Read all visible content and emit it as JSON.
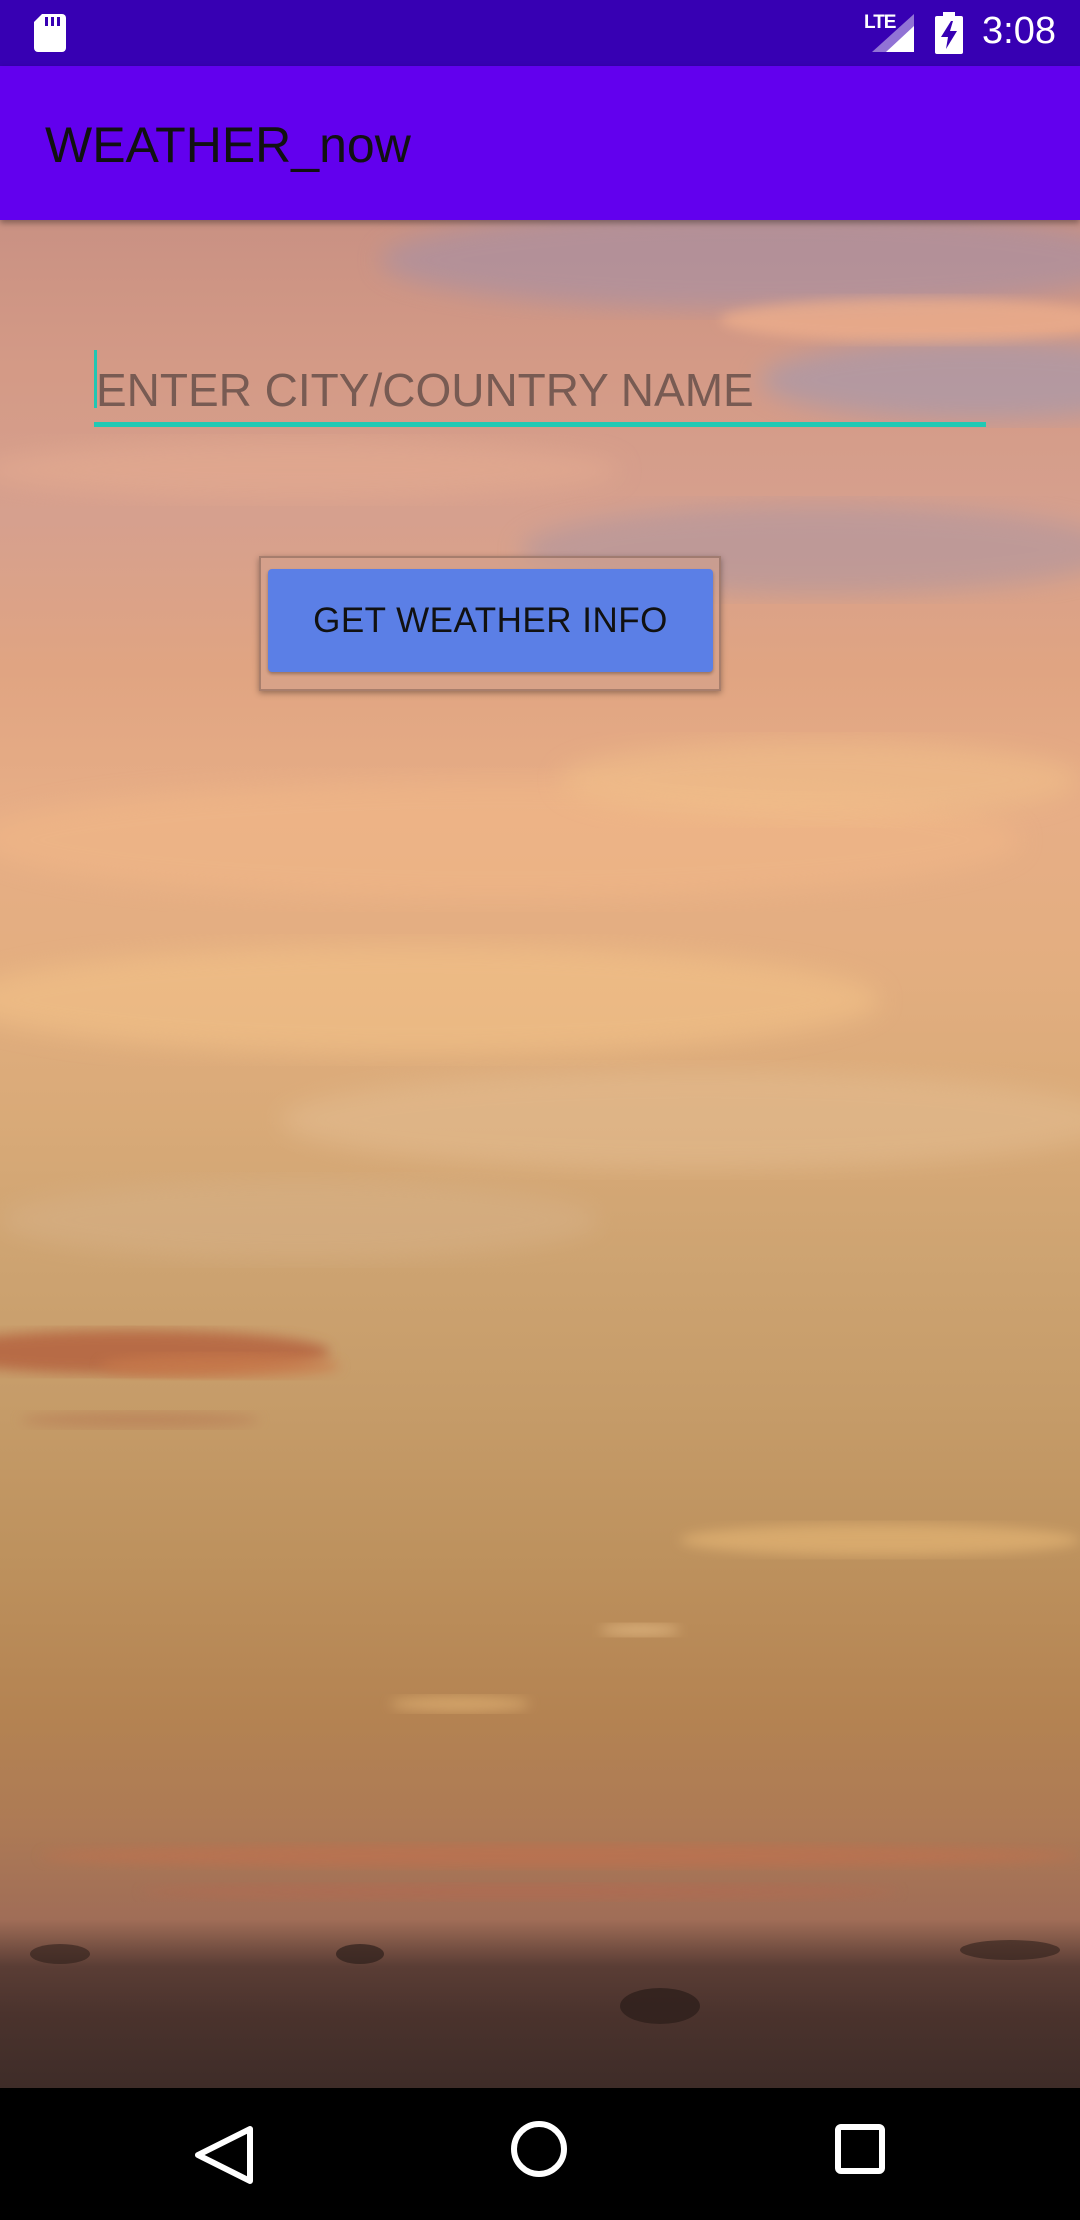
{
  "status_bar": {
    "time": "3:08",
    "network_label": "LTE",
    "icons": [
      "sd-card-icon",
      "signal-icon",
      "battery-charging-icon"
    ]
  },
  "app_bar": {
    "title": "WEATHER_now"
  },
  "search": {
    "placeholder": "ENTER CITY/COUNTRY NAME",
    "value": ""
  },
  "actions": {
    "get_weather_label": "GET WEATHER INFO"
  },
  "nav_bar": {
    "icons": [
      "back-icon",
      "home-icon",
      "recents-icon"
    ]
  },
  "colors": {
    "status_bar": "#3700B3",
    "app_bar": "#6200EE",
    "input_underline": "#20C9B4",
    "button": "#5B7FE6"
  }
}
